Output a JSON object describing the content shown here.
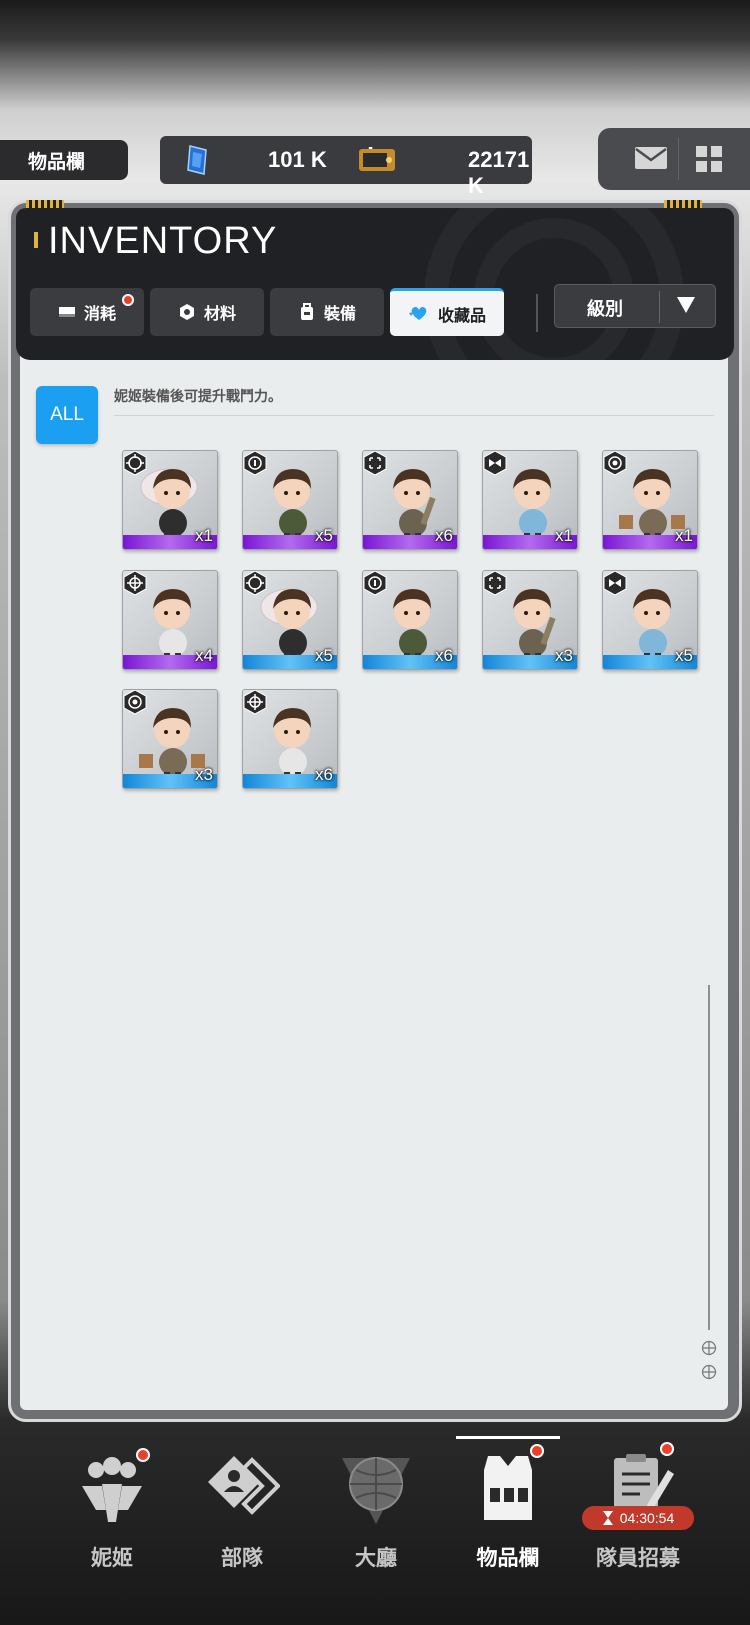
{
  "header": {
    "page_label": "物品欄",
    "gem_value": "101 K",
    "gem_plus": "+",
    "ticket_value": "22171 K",
    "icons": [
      "gem-icon",
      "ticket-icon",
      "mail-icon",
      "grid-menu-icon"
    ]
  },
  "panel": {
    "title": "INVENTORY",
    "tabs": [
      {
        "label": "消耗",
        "icon": "consumable-icon",
        "badge": true,
        "active": false
      },
      {
        "label": "材料",
        "icon": "hex-nut-icon",
        "badge": false,
        "active": false
      },
      {
        "label": "裝備",
        "icon": "backpack-icon",
        "badge": false,
        "active": false
      },
      {
        "label": "收藏品",
        "icon": "heart-wing-icon",
        "badge": false,
        "active": true
      }
    ],
    "sort": {
      "label": "級別",
      "icon": "dropdown-arrow-icon"
    }
  },
  "content": {
    "filter_label": "ALL",
    "hint": "妮姬裝備後可提升戰鬥力。",
    "items": [
      {
        "count": "x1",
        "rarity": "purple",
        "type_icon": "crosshair-ring-icon",
        "pose": "sleeping"
      },
      {
        "count": "x5",
        "rarity": "purple",
        "type_icon": "info-circle-icon",
        "pose": "praying"
      },
      {
        "count": "x6",
        "rarity": "purple",
        "type_icon": "target-corners-icon",
        "pose": "holding-gun"
      },
      {
        "count": "x1",
        "rarity": "purple",
        "type_icon": "bowtie-icon",
        "pose": "shocked"
      },
      {
        "count": "x1",
        "rarity": "purple",
        "type_icon": "dot-circle-icon",
        "pose": "bags"
      },
      {
        "count": "x4",
        "rarity": "purple",
        "type_icon": "crosshair-icon",
        "pose": "standing"
      },
      {
        "count": "x5",
        "rarity": "blue",
        "type_icon": "crosshair-ring-icon",
        "pose": "sleeping"
      },
      {
        "count": "x6",
        "rarity": "blue",
        "type_icon": "info-circle-icon",
        "pose": "praying"
      },
      {
        "count": "x3",
        "rarity": "blue",
        "type_icon": "target-corners-icon",
        "pose": "holding-gun"
      },
      {
        "count": "x5",
        "rarity": "blue",
        "type_icon": "bowtie-icon",
        "pose": "shocked"
      },
      {
        "count": "x3",
        "rarity": "blue",
        "type_icon": "dot-circle-icon",
        "pose": "bags"
      },
      {
        "count": "x6",
        "rarity": "blue",
        "type_icon": "crosshair-icon",
        "pose": "standing"
      }
    ]
  },
  "nav": {
    "items": [
      {
        "label": "妮姬",
        "icon": "nikke-people-icon",
        "badge": true,
        "active": false
      },
      {
        "label": "部隊",
        "icon": "squad-card-icon",
        "badge": false,
        "active": false
      },
      {
        "label": "大廳",
        "icon": "lobby-globe-icon",
        "badge": false,
        "active": false
      },
      {
        "label": "物品欄",
        "icon": "inventory-vest-icon",
        "badge": true,
        "active": true
      },
      {
        "label": "隊員招募",
        "icon": "recruit-clipboard-icon",
        "badge": true,
        "active": false
      }
    ],
    "timer": "04:30:54"
  },
  "colors": {
    "accent_blue": "#1a9ff1",
    "purple_rarity": "#8f2fe0",
    "blue_rarity": "#2fa6ee",
    "badge_red": "#e8402b",
    "dark_panel": "#202124"
  }
}
